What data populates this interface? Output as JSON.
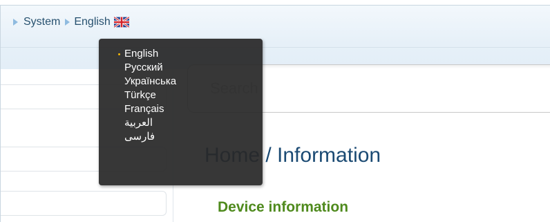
{
  "breadcrumb": {
    "items": [
      "System",
      "English"
    ],
    "flag_icon": "uk-flag-icon"
  },
  "language_menu": {
    "selected": "English",
    "options": [
      "English",
      "Русский",
      "Українська",
      "Türkçe",
      "Français",
      "العربية",
      "فارسی"
    ]
  },
  "search": {
    "placeholder": "Search",
    "value": ""
  },
  "page": {
    "title": "Home /  Information",
    "section_title": "Device information"
  },
  "colors": {
    "title": "#1b4a73",
    "section_title": "#4f8a1d",
    "menu_bg": "#282828",
    "active_bullet": "#f2b705",
    "topbar": "#e6f0f8"
  }
}
